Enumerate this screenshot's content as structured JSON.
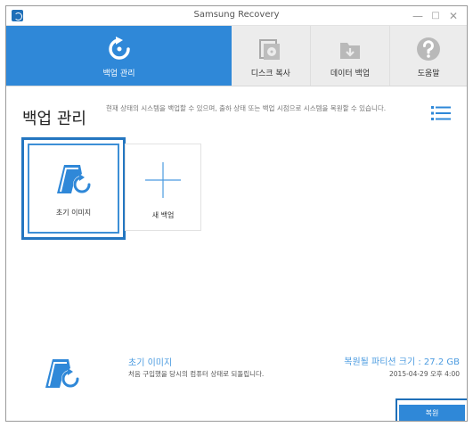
{
  "window": {
    "title": "Samsung Recovery",
    "controls": {
      "minimize": "—",
      "maximize": "□",
      "close": "✕"
    }
  },
  "toolbar": {
    "items": [
      {
        "label": "백업 관리",
        "icon": "backup-restore-icon",
        "active": true
      },
      {
        "label": "디스크 복사",
        "icon": "disk-copy-icon",
        "active": false
      },
      {
        "label": "데이터 백업",
        "icon": "data-backup-icon",
        "active": false
      },
      {
        "label": "도움말",
        "icon": "help-icon",
        "active": false
      }
    ]
  },
  "header": {
    "title": "백업 관리",
    "description": "현재 상태의 시스템을 백업할 수 있으며, 출하 상태 또는 백업 시점으로 시스템을 복원할 수 있습니다."
  },
  "tiles": [
    {
      "label": "초기 이미지",
      "icon": "initial-image-icon",
      "selected": true
    },
    {
      "label": "새 백업",
      "icon": "plus-icon",
      "selected": false
    }
  ],
  "info": {
    "name": "초기 이미지",
    "description": "처음 구입했을 당시의 컴퓨터 상태로 되돌립니다.",
    "partition_size": "복원될 파티션 크기 : 27.2 GB",
    "date": "2015-04-29 오후 4:00"
  },
  "actions": {
    "restore_label": "복원"
  },
  "colors": {
    "accent": "#2f88d8",
    "accent_dark": "#1f6fb8",
    "info_text": "#4b9be0"
  }
}
